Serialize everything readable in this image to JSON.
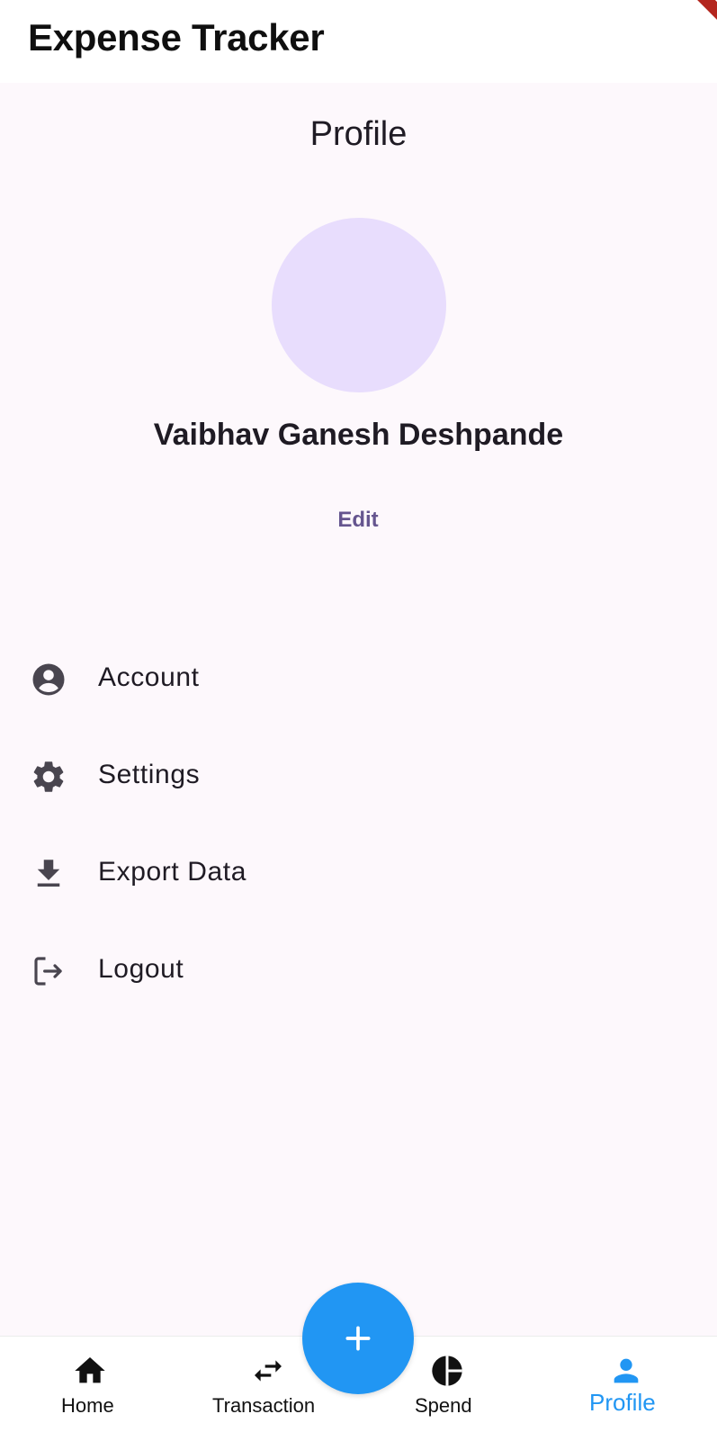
{
  "app_bar": {
    "title": "Expense Tracker"
  },
  "page": {
    "heading": "Profile"
  },
  "profile": {
    "name": "Vaibhav Ganesh Deshpande",
    "edit_label": "Edit",
    "avatar_color": "#e8ddfd"
  },
  "menu": {
    "items": [
      {
        "label": "Account",
        "icon": "account-circle-icon"
      },
      {
        "label": "Settings",
        "icon": "gear-icon"
      },
      {
        "label": "Export Data",
        "icon": "download-icon"
      },
      {
        "label": "Logout",
        "icon": "logout-icon"
      }
    ]
  },
  "bottom_nav": {
    "items": [
      {
        "label": "Home",
        "icon": "home-icon",
        "active": false
      },
      {
        "label": "Transaction",
        "icon": "swap-arrows-icon",
        "active": false
      },
      {
        "label": "Spend",
        "icon": "pie-chart-icon",
        "active": false
      },
      {
        "label": "Profile",
        "icon": "person-icon",
        "active": true
      }
    ],
    "fab_icon": "plus-icon"
  },
  "colors": {
    "background": "#fdf8fc",
    "accent": "#2196f3",
    "edit_text": "#65558f",
    "icon": "#49454f"
  }
}
